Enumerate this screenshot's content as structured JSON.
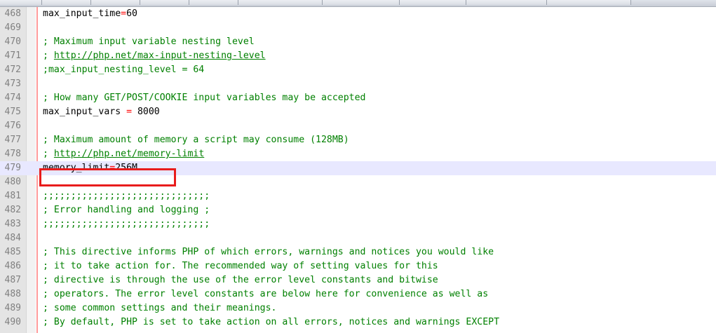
{
  "tabs": [
    "",
    "",
    "",
    "",
    "",
    "",
    "",
    "",
    "",
    ""
  ],
  "colors": {
    "comment": "#008000",
    "operator": "#ff0000",
    "highlight": "#e81c1c",
    "line_number": "#808080",
    "current_line": "#e8e8ff"
  },
  "lines": [
    {
      "n": "468",
      "parts": [
        {
          "t": "max_input_time",
          "c": "kw"
        },
        {
          "t": "=",
          "c": "op"
        },
        {
          "t": "60",
          "c": "kw"
        }
      ]
    },
    {
      "n": "469",
      "parts": []
    },
    {
      "n": "470",
      "parts": [
        {
          "t": "; Maximum input variable nesting level",
          "c": "cm"
        }
      ]
    },
    {
      "n": "471",
      "parts": [
        {
          "t": "; ",
          "c": "cm"
        },
        {
          "t": "http://php.net/max-input-nesting-level",
          "c": "link"
        }
      ]
    },
    {
      "n": "472",
      "parts": [
        {
          "t": ";max_input_nesting_level = 64",
          "c": "cm"
        }
      ]
    },
    {
      "n": "473",
      "parts": []
    },
    {
      "n": "474",
      "parts": [
        {
          "t": "; How many GET/POST/COOKIE input variables may be accepted",
          "c": "cm"
        }
      ]
    },
    {
      "n": "475",
      "parts": [
        {
          "t": "max_input_vars ",
          "c": "kw"
        },
        {
          "t": "=",
          "c": "op"
        },
        {
          "t": " 8000",
          "c": "kw"
        }
      ]
    },
    {
      "n": "476",
      "parts": []
    },
    {
      "n": "477",
      "parts": [
        {
          "t": "; Maximum amount of memory a script may consume (128MB)",
          "c": "cm"
        }
      ]
    },
    {
      "n": "478",
      "parts": [
        {
          "t": "; ",
          "c": "cm"
        },
        {
          "t": "http://php.net/memory-limit",
          "c": "link"
        }
      ]
    },
    {
      "n": "479",
      "current": true,
      "parts": [
        {
          "t": "memory_limit",
          "c": "kw"
        },
        {
          "t": "=",
          "c": "op"
        },
        {
          "t": "256M",
          "c": "kw"
        }
      ]
    },
    {
      "n": "480",
      "parts": []
    },
    {
      "n": "481",
      "parts": [
        {
          "t": ";;;;;;;;;;;;;;;;;;;;;;;;;;;;;;",
          "c": "cm"
        }
      ]
    },
    {
      "n": "482",
      "parts": [
        {
          "t": "; Error handling and logging ;",
          "c": "cm"
        }
      ]
    },
    {
      "n": "483",
      "parts": [
        {
          "t": ";;;;;;;;;;;;;;;;;;;;;;;;;;;;;;",
          "c": "cm"
        }
      ]
    },
    {
      "n": "484",
      "parts": []
    },
    {
      "n": "485",
      "parts": [
        {
          "t": "; This directive informs PHP of which errors, warnings and notices you would like",
          "c": "cm"
        }
      ]
    },
    {
      "n": "486",
      "parts": [
        {
          "t": "; it to take action for. The recommended way of setting values for this",
          "c": "cm"
        }
      ]
    },
    {
      "n": "487",
      "parts": [
        {
          "t": "; directive is through the use of the error level constants and bitwise",
          "c": "cm"
        }
      ]
    },
    {
      "n": "488",
      "parts": [
        {
          "t": "; operators. The error level constants are below here for convenience as well as",
          "c": "cm"
        }
      ]
    },
    {
      "n": "489",
      "parts": [
        {
          "t": "; some common settings and their meanings.",
          "c": "cm"
        }
      ]
    },
    {
      "n": "490",
      "parts": [
        {
          "t": "; By default, PHP is set to take action on all errors, notices and warnings EXCEPT",
          "c": "cm"
        }
      ]
    }
  ]
}
